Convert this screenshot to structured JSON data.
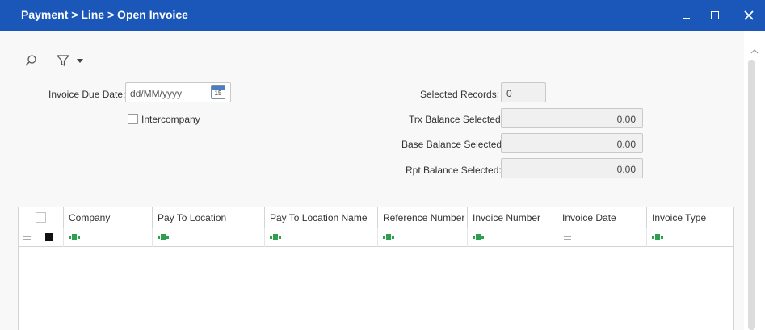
{
  "window": {
    "title": "Payment > Line > Open Invoice"
  },
  "toolbar": {
    "search_icon": "search-icon",
    "filter_icon": "filter-icon"
  },
  "form": {
    "invoice_due_date": {
      "label": "Invoice Due Date:",
      "placeholder": "dd/MM/yyyy",
      "calendar_day": "15"
    },
    "intercompany": {
      "label": "Intercompany",
      "checked": false
    },
    "selected_records": {
      "label": "Selected Records:",
      "value": "0"
    },
    "trx_balance": {
      "label": "Trx Balance Selected:",
      "value": "0.00"
    },
    "base_balance": {
      "label": "Base Balance Selected:",
      "value": "0.00"
    },
    "rpt_balance": {
      "label": "Rpt Balance Selected:",
      "value": "0.00"
    }
  },
  "grid": {
    "columns": [
      "Company",
      "Pay To Location",
      "Pay To Location Name",
      "Reference Number",
      "Invoice Number",
      "Invoice Date",
      "Invoice Type"
    ],
    "filter_types": [
      "text",
      "text",
      "text",
      "text",
      "text",
      "equals",
      "text"
    ],
    "rows": []
  },
  "colors": {
    "titlebar": "#1a57b8",
    "abc_green": "#2e9e4f"
  }
}
